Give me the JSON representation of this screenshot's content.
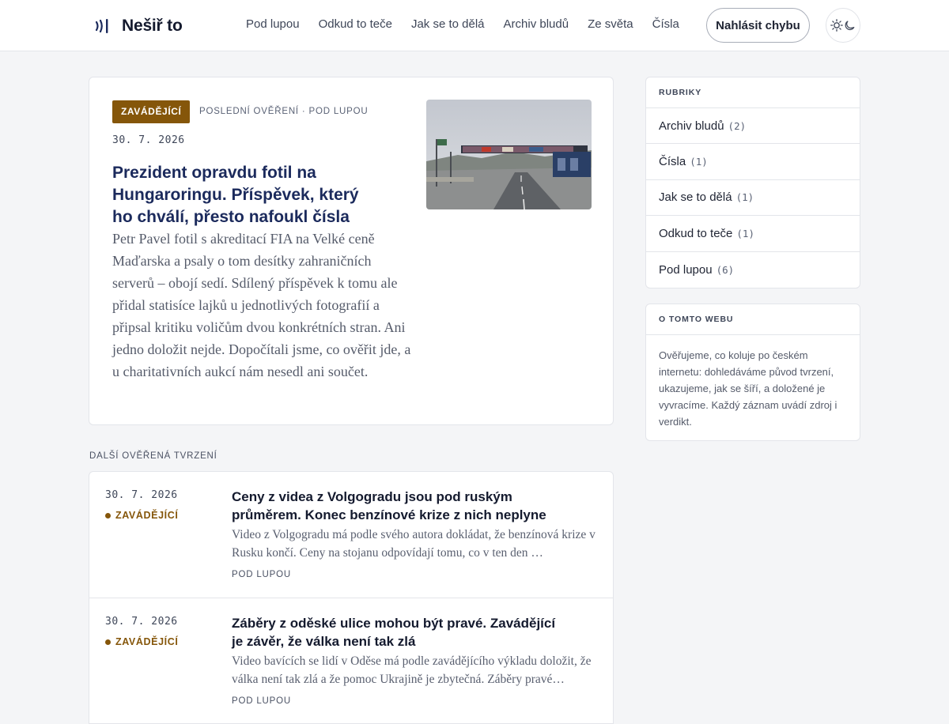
{
  "brand": {
    "name": "Nešiř to"
  },
  "nav": [
    "Pod lupou",
    "Odkud to teče",
    "Jak se to dělá",
    "Archiv bludů",
    "Ze světa",
    "Čísla"
  ],
  "header": {
    "report_label": "Nahlásit chybu"
  },
  "featured": {
    "verdict": "ZAVÁDĚJÍCÍ",
    "meta": "POSLEDNÍ OVĚŘENÍ · POD LUPOU",
    "date": "30. 7. 2026",
    "title": "Prezident opravdu fotil na Hungaroringu. Příspěvek, který ho chválí, přesto nafoukl čísla",
    "body": "Petr Pavel fotil s akreditací FIA na Velké ceně Maďarska a psaly o tom desítky zahraničních serverů – obojí sedí. Sdílený příspěvek k tomu ale přidal statisíce lajků u jednotlivých fotografií a připsal kritiku voličům dvou konkrétních stran. Ani jedno doložit nejde. Dopočítali jsme, co ověřit jde, a u charitativních aukcí nám nesedl ani součet."
  },
  "more_label": "DALŠÍ OVĚŘENÁ TVRZENÍ",
  "articles": [
    {
      "date": "30. 7. 2026",
      "verdict": "ZAVÁDĚJÍCÍ",
      "title": "Ceny z videa z Volgogradu jsou pod ruským průměrem. Konec benzínové krize z nich neplyne",
      "summary": "Video z Volgogradu má podle svého autora dokládat, že benzínová krize v Rusku končí. Ceny na stojanu odpovídají tomu, co v ten den …",
      "category": "POD LUPOU"
    },
    {
      "date": "30. 7. 2026",
      "verdict": "ZAVÁDĚJÍCÍ",
      "title": "Záběry z oděské ulice mohou být pravé. Zavádějící je závěr, že válka není tak zlá",
      "summary": "Video bavících se lidí v Oděse má podle zavádějícího výkladu doložit, že válka není tak zlá a že pomoc Ukrajině je zbytečná. Záběry pravé…",
      "category": "POD LUPOU"
    }
  ],
  "sidebar": {
    "categories_title": "RUBRIKY",
    "categories": [
      {
        "name": "Archiv bludů",
        "count": "(2)"
      },
      {
        "name": "Čísla",
        "count": "(1)"
      },
      {
        "name": "Jak se to dělá",
        "count": "(1)"
      },
      {
        "name": "Odkud to teče",
        "count": "(1)"
      },
      {
        "name": "Pod lupou",
        "count": "(6)"
      }
    ],
    "about_title": "O TOMTO WEBU",
    "about_text": "Ověřujeme, co koluje po českém internetu: dohledáváme původ tvrzení, ukazujeme, jak se šíří, a doložené je vyvracíme. Každý záznam uvádí zdroj i verdikt."
  },
  "colors": {
    "accent": "#1b2a5c",
    "verdict": "#85560a",
    "page_bg": "#f4f5f7"
  },
  "icons": {
    "logo": "signal-waves-icon",
    "theme": [
      "sun-icon",
      "moon-icon"
    ]
  }
}
